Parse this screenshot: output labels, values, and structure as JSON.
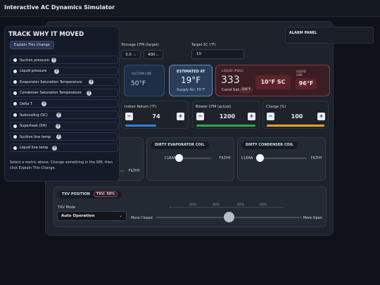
{
  "app": {
    "title": "Interactive AC Dynamics Simulator"
  },
  "settings": {
    "tonnage_label": "Tonnage CFM (target)",
    "tonnage_value": "3.0",
    "cfm_value": "400",
    "target_sc_label": "Target SC (°F)",
    "target_sc_value": "10"
  },
  "alarm_panel": {
    "title": "ALARM PANEL"
  },
  "cards": {
    "suction": {
      "label": "SUCTION LINE",
      "value": "50°F"
    },
    "evap": {
      "label": "ESTIMATED AT",
      "value": "19°F",
      "sub": "Supply Air: 55°F"
    },
    "liquid": {
      "label": "LIQUID (PSIG)",
      "pressure": "333",
      "cond_sat_label": "Cond Sat:",
      "cond_sat_value": "106°F",
      "sc": "10°F SC",
      "line_label": "LIQUID LINE",
      "line_value": "96°F"
    }
  },
  "controls": {
    "return": {
      "label": "Indoor Return (°F)",
      "value": "74",
      "color": "#2f80d9"
    },
    "blower": {
      "label": "Blower CFM (actual)",
      "value": "1200",
      "color": "#2fa84a"
    },
    "charge": {
      "label": "Charge (%)",
      "value": "100",
      "color": "#e6a31c"
    }
  },
  "coils": {
    "left": {
      "end": "FILTHY"
    },
    "evap": {
      "title": "DIRTY EVAPORATOR COIL",
      "start": "CLEAN",
      "end": "FILTHY"
    },
    "cond": {
      "title": "DIRTY CONDENSER COIL",
      "start": "CLEAN",
      "end": "FILTHY"
    }
  },
  "txv": {
    "title": "TXV POSITION",
    "badge": "TXV: 50%",
    "mode_label": "TXV Mode",
    "mode_value": "Auto Operation",
    "ticks": [
      "20%",
      "40%",
      "60%",
      "80%"
    ],
    "min_label": "More Closed",
    "max_label": "More Open",
    "position_fraction": 0.5
  },
  "sidebar": {
    "title": "TRACK WHY IT MOVED",
    "explain_label": "Explain This Change",
    "metrics": [
      {
        "label": "Suction pressure"
      },
      {
        "label": "Liquid pressure"
      },
      {
        "label": "Evaporator Saturation Temperature"
      },
      {
        "label": "Condenser Saturation Temperature"
      },
      {
        "label": "Delta T"
      },
      {
        "label": "Subcooling (SC)"
      },
      {
        "label": "Superheat (SH)"
      },
      {
        "label": "Suction line temp"
      },
      {
        "label": "Liquid line temp"
      }
    ],
    "help": "Select a metric above. Change something in the SIM, then click Explain This Change."
  }
}
